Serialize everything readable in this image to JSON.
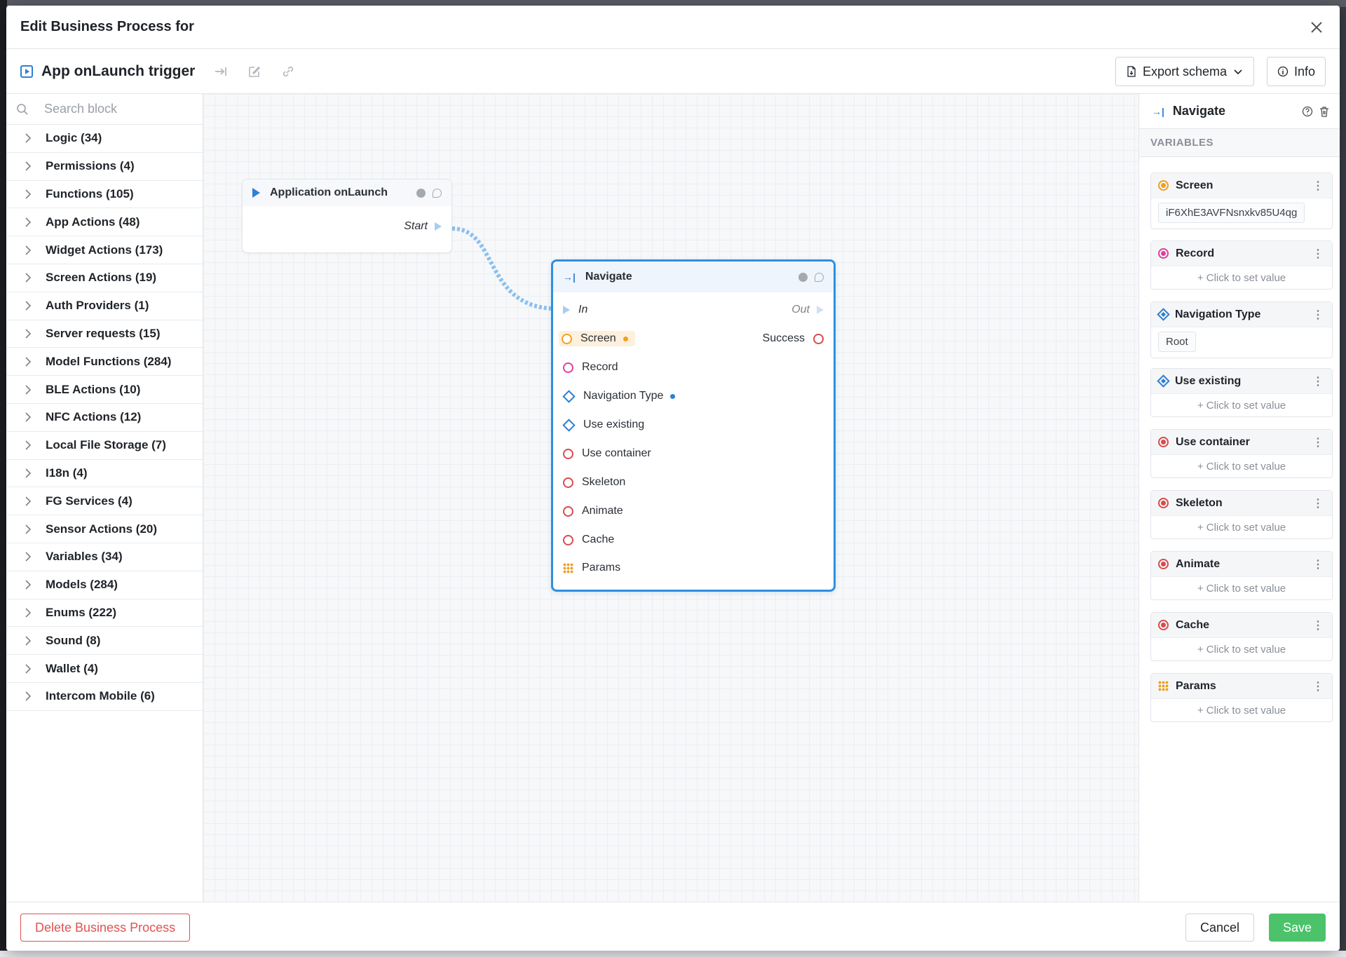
{
  "modal": {
    "title": "Edit Business Process for"
  },
  "toolbar": {
    "process_name": "App onLaunch trigger",
    "export_label": "Export schema",
    "info_label": "Info"
  },
  "sidebar": {
    "search_placeholder": "Search block",
    "categories": [
      "Logic (34)",
      "Permissions (4)",
      "Functions (105)",
      "App Actions (48)",
      "Widget Actions (173)",
      "Screen Actions (19)",
      "Auth Providers (1)",
      "Server requests (15)",
      "Model Functions (284)",
      "BLE Actions (10)",
      "NFC Actions (12)",
      "Local File Storage (7)",
      "I18n (4)",
      "FG Services (4)",
      "Sensor Actions (20)",
      "Variables (34)",
      "Models (284)",
      "Enums (222)",
      "Sound (8)",
      "Wallet (4)",
      "Intercom Mobile (6)"
    ]
  },
  "canvas": {
    "launch_node": {
      "title": "Application onLaunch",
      "start_label": "Start"
    },
    "navigate_node": {
      "title": "Navigate",
      "in_label": "In",
      "out_label": "Out",
      "success_label": "Success",
      "inputs": [
        "Screen",
        "Record",
        "Navigation Type",
        "Use existing",
        "Use container",
        "Skeleton",
        "Animate",
        "Cache",
        "Params"
      ]
    }
  },
  "right_panel": {
    "title": "Navigate",
    "section_label": "VARIABLES",
    "set_value_label": "+ Click to set value",
    "variables": [
      {
        "name": "Screen",
        "value": "iF6XhE3AVFNsnxkv85U4qg"
      },
      {
        "name": "Record"
      },
      {
        "name": "Navigation Type",
        "value": "Root"
      },
      {
        "name": "Use existing"
      },
      {
        "name": "Use container"
      },
      {
        "name": "Skeleton"
      },
      {
        "name": "Animate"
      },
      {
        "name": "Cache"
      },
      {
        "name": "Params"
      }
    ]
  },
  "footer": {
    "delete_label": "Delete Business Process",
    "cancel_label": "Cancel",
    "save_label": "Save"
  },
  "colors": {
    "accent": "#2f80d1",
    "save": "#4cc36a",
    "danger": "#e05252",
    "screen_orange": "#f0a020",
    "record_pink": "#e0409c",
    "boolean_red": "#d94b4b"
  }
}
